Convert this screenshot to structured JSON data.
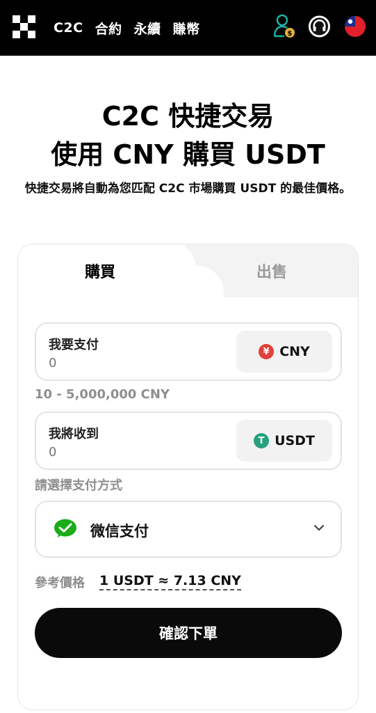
{
  "nav": {
    "items": [
      "C2C",
      "合約",
      "永續",
      "賺幣"
    ]
  },
  "hero": {
    "title_line1": "C2C 快捷交易",
    "title_line2": "使用 CNY 購買 USDT",
    "description": "快捷交易將自動為您匹配 C2C 市場購買 USDT 的最佳價格。"
  },
  "tabs": {
    "buy": "購買",
    "sell": "出售"
  },
  "pay": {
    "label": "我要支付",
    "placeholder": "0",
    "currency": "CNY",
    "currency_symbol": "¥",
    "range": "10 - 5,000,000 CNY"
  },
  "receive": {
    "label": "我將收到",
    "placeholder": "0",
    "currency": "USDT",
    "currency_symbol": "T"
  },
  "payment_method": {
    "label": "請選擇支付方式",
    "selected": "微信支付"
  },
  "reference": {
    "label": "參考價格",
    "value": "1 USDT ≈ 7.13 CNY"
  },
  "confirm_label": "確認下單",
  "colors": {
    "cny": "#e0403a",
    "usdt": "#26a17b",
    "wechat": "#1aad19",
    "agent_icon": "#1db3a6"
  },
  "icons": [
    "okx-logo-icon",
    "agent-coin-icon",
    "headset-icon",
    "taiwan-flag-icon",
    "wechat-icon",
    "chevron-down-icon"
  ]
}
